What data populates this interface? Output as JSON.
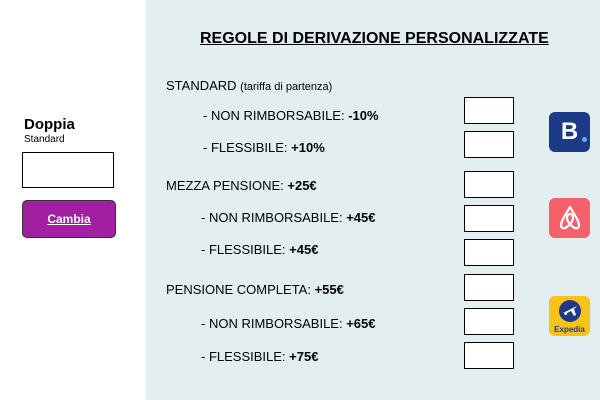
{
  "room": {
    "name": "Doppia",
    "subtitle": "Standard",
    "change_label": "Cambia"
  },
  "title": "REGOLE DI DERIVAZIONE PERSONALIZZATE",
  "rules": [
    {
      "label": "STANDARD",
      "note": "(tariffa di partenza)",
      "value": ""
    },
    {
      "label": "- NON RIMBORSABILE:",
      "value": "-10%"
    },
    {
      "label": "- FLESSIBILE:",
      "value": "+10%"
    },
    {
      "label": "MEZZA PENSIONE:",
      "value": "+25€"
    },
    {
      "label": "- NON RIMBORSABILE:",
      "value": "+45€"
    },
    {
      "label": "- FLESSIBILE:",
      "value": "+45€"
    },
    {
      "label": "PENSIONE COMPLETA:",
      "value": "+55€"
    },
    {
      "label": "- NON RIMBORSABILE:",
      "value": "+65€"
    },
    {
      "label": "- FLESSIBILE:",
      "value": "+75€"
    }
  ],
  "logos": {
    "booking": {
      "text": "B",
      "icon": "booking-logo",
      "color": "#1d3a87"
    },
    "airbnb": {
      "icon": "airbnb-logo",
      "color": "#f5616b"
    },
    "expedia": {
      "text": "Expedia",
      "icon": "expedia-logo",
      "color": "#f8c21a"
    }
  }
}
